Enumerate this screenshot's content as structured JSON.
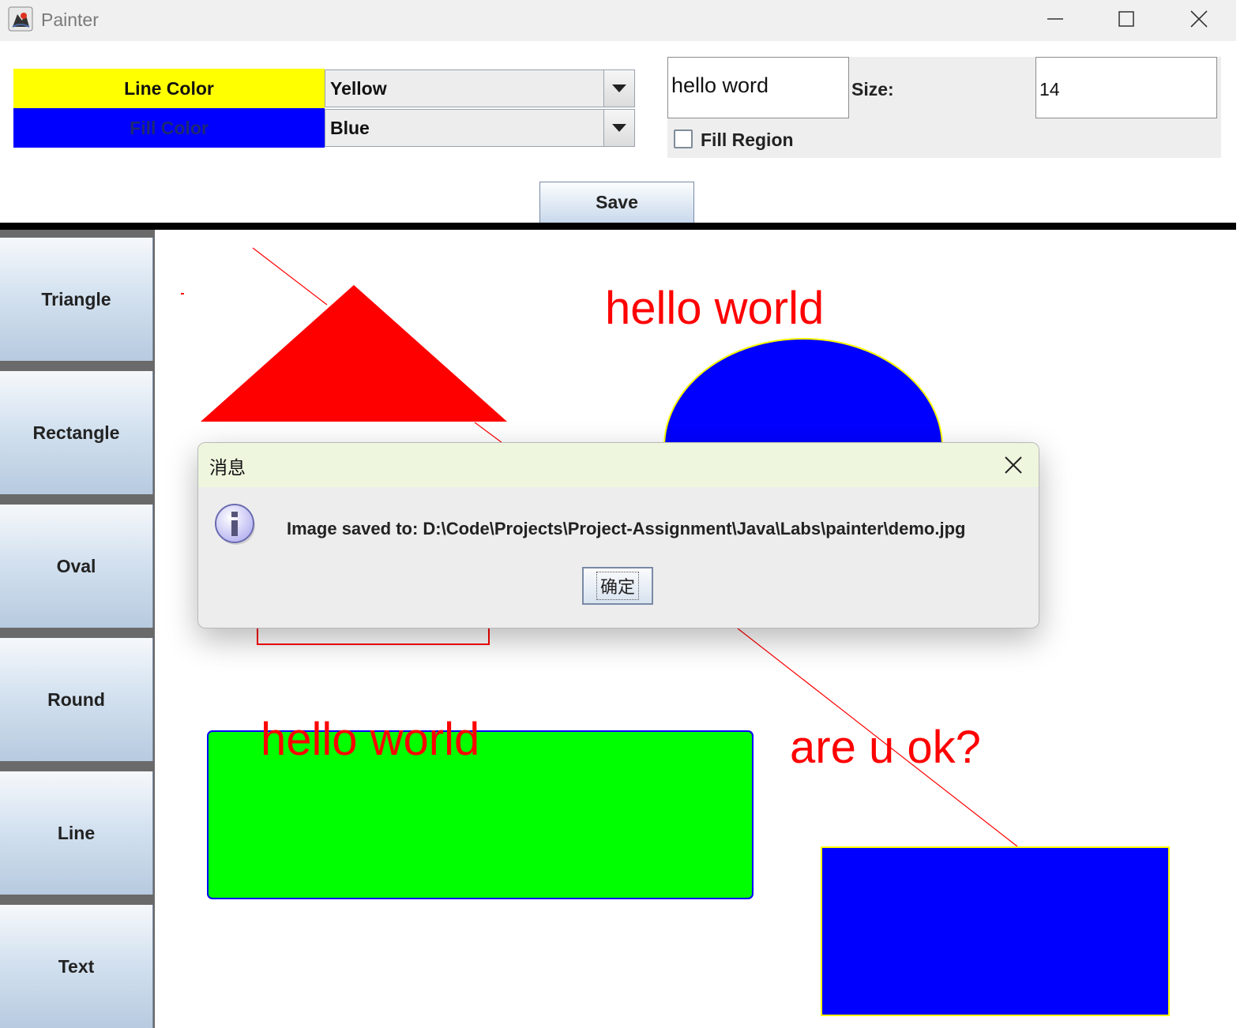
{
  "window": {
    "title": "Painter",
    "icon": "java-app-icon",
    "controls": [
      "minimize-icon",
      "maximize-icon",
      "close-icon"
    ]
  },
  "toolbar": {
    "line_color_label": "Line Color",
    "line_color_value": "Yellow",
    "fill_color_label": "Fill Color",
    "fill_color_value": "Blue",
    "text_value": "hello word",
    "size_label": "Size:",
    "size_value": "14",
    "fill_region_label": "Fill Region",
    "fill_region_checked": false,
    "save_label": "Save"
  },
  "sidebar": {
    "tools": [
      "Triangle",
      "Rectangle",
      "Oval",
      "Round",
      "Line",
      "Text"
    ]
  },
  "canvas": {
    "texts": [
      "hello world",
      "hello world",
      "are u ok?"
    ],
    "colors": {
      "red": "#ff0000",
      "green": "#00ff00",
      "blue": "#0000ff",
      "yellow": "#ffff00"
    }
  },
  "dialog": {
    "title": "消息",
    "icon": "info-icon",
    "message": "Image saved to: D:\\Code\\Projects\\Project-Assignment\\Java\\Labs\\painter\\demo.jpg",
    "ok_label": "确定"
  }
}
